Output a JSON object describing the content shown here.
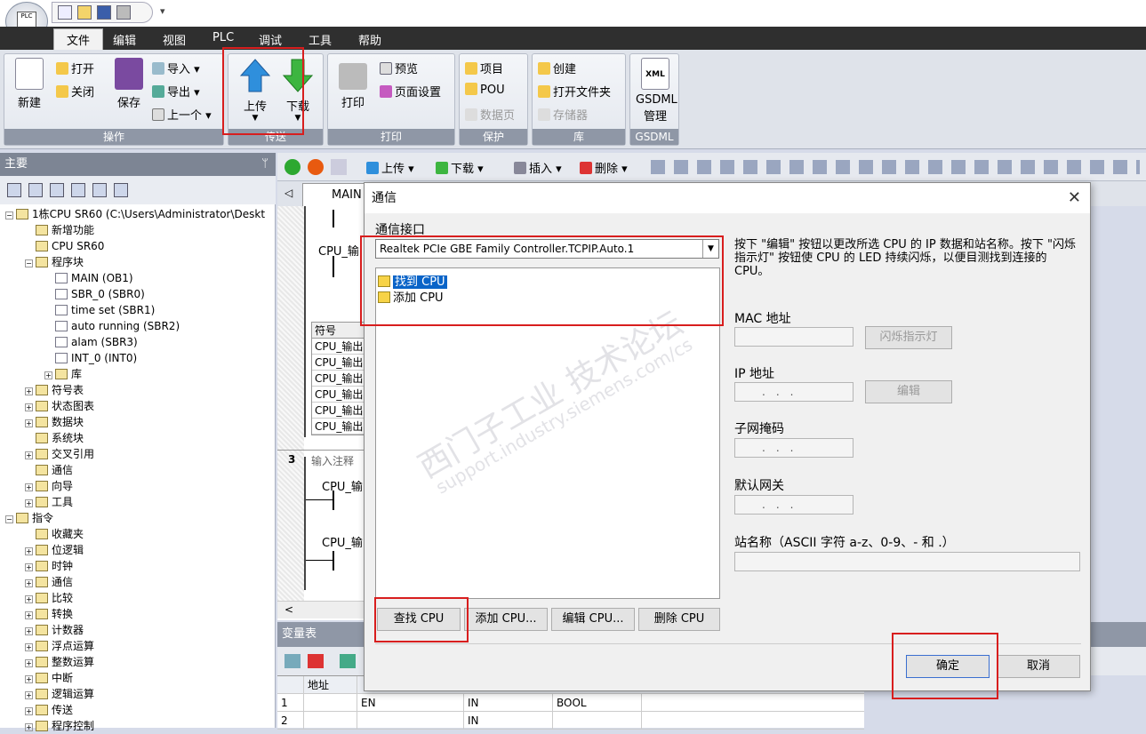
{
  "quick_access_more": "▾",
  "menu": {
    "tabs": [
      "文件",
      "编辑",
      "视图",
      "PLC",
      "调试",
      "工具",
      "帮助"
    ],
    "active": "文件"
  },
  "ribbon": {
    "ops": {
      "caption": "操作",
      "new": "新建",
      "open": "打开",
      "close": "关闭",
      "save": "保存",
      "import": "导入",
      "export": "导出",
      "previous": "上一个"
    },
    "transfer": {
      "caption": "传送",
      "upload": "上传",
      "download": "下载"
    },
    "print": {
      "caption": "打印",
      "print": "打印",
      "preview": "预览",
      "page_setup": "页面设置"
    },
    "protect": {
      "caption": "保护",
      "project": "项目",
      "pou": "POU",
      "data_page": "数据页"
    },
    "library": {
      "caption": "库",
      "create": "创建",
      "open_folder": "打开文件夹",
      "memory": "存储器"
    },
    "gsdml": {
      "caption": "GSDML",
      "label1": "GSDML",
      "label2": "管理",
      "icon_text": "XML"
    }
  },
  "left_pane": {
    "title": "主要",
    "pin": "ᛘ",
    "tree": [
      {
        "label": "1栋CPU SR60 (C:\\Users\\Administrator\\Deskt",
        "level": 0,
        "exp": "−"
      },
      {
        "label": "新增功能",
        "level": 1
      },
      {
        "label": "CPU SR60",
        "level": 1
      },
      {
        "label": "程序块",
        "level": 1,
        "exp": "−"
      },
      {
        "label": "MAIN (OB1)",
        "level": 2
      },
      {
        "label": "SBR_0 (SBR0)",
        "level": 2
      },
      {
        "label": "time set (SBR1)",
        "level": 2
      },
      {
        "label": "auto running (SBR2)",
        "level": 2
      },
      {
        "label": "alam (SBR3)",
        "level": 2
      },
      {
        "label": "INT_0 (INT0)",
        "level": 2
      },
      {
        "label": "库",
        "level": 2,
        "exp": "+"
      },
      {
        "label": "符号表",
        "level": 1,
        "exp": "+"
      },
      {
        "label": "状态图表",
        "level": 1,
        "exp": "+"
      },
      {
        "label": "数据块",
        "level": 1,
        "exp": "+"
      },
      {
        "label": "系统块",
        "level": 1
      },
      {
        "label": "交叉引用",
        "level": 1,
        "exp": "+"
      },
      {
        "label": "通信",
        "level": 1
      },
      {
        "label": "向导",
        "level": 1,
        "exp": "+"
      },
      {
        "label": "工具",
        "level": 1,
        "exp": "+"
      },
      {
        "label": "指令",
        "level": 0,
        "exp": "−"
      },
      {
        "label": "收藏夹",
        "level": 1
      },
      {
        "label": "位逻辑",
        "level": 1,
        "exp": "+"
      },
      {
        "label": "时钟",
        "level": 1,
        "exp": "+"
      },
      {
        "label": "通信",
        "level": 1,
        "exp": "+"
      },
      {
        "label": "比较",
        "level": 1,
        "exp": "+"
      },
      {
        "label": "转换",
        "level": 1,
        "exp": "+"
      },
      {
        "label": "计数器",
        "level": 1,
        "exp": "+"
      },
      {
        "label": "浮点运算",
        "level": 1,
        "exp": "+"
      },
      {
        "label": "整数运算",
        "level": 1,
        "exp": "+"
      },
      {
        "label": "中断",
        "level": 1,
        "exp": "+"
      },
      {
        "label": "逻辑运算",
        "level": 1,
        "exp": "+"
      },
      {
        "label": "传送",
        "level": 1,
        "exp": "+"
      },
      {
        "label": "程序控制",
        "level": 1,
        "exp": "+"
      }
    ]
  },
  "editor_toolbar": {
    "upload": "上传",
    "download": "下载",
    "insert": "插入",
    "delete": "删除",
    "dropdown": "▾"
  },
  "editor": {
    "tab": "MAIN",
    "nav_left": "◁",
    "nav_bottom": "<",
    "rung_label_1": "CPU_输",
    "rung_label_2": "CPU_输",
    "rung_label_3": "CPU_输",
    "symbol_header": "符号",
    "symbol_rows": [
      "CPU_输出",
      "CPU_输出",
      "CPU_输出",
      "CPU_输出",
      "CPU_输出",
      "CPU_输出"
    ],
    "network3": "3",
    "comment": "输入注释"
  },
  "var_table": {
    "title": "变量表",
    "col_address": "地址",
    "rows": [
      {
        "n": "1",
        "name": "EN",
        "type": "IN",
        "dtype": "BOOL"
      },
      {
        "n": "2",
        "name": "",
        "type": "IN",
        "dtype": ""
      }
    ]
  },
  "dialog": {
    "title": "通信",
    "close": "✕",
    "interface_label": "通信接口",
    "interface_value": "Realtek PCIe GBE Family Controller.TCPIP.Auto.1",
    "select_arrow": "▼",
    "cpu_items": [
      {
        "label": "找到 CPU",
        "selected": true
      },
      {
        "label": "添加 CPU",
        "selected": false
      }
    ],
    "help": "按下 \"编辑\" 按钮以更改所选 CPU 的 IP 数据和站名称。按下 \"闪烁指示灯\" 按钮使 CPU 的 LED 持续闪烁，以便目测找到连接的 CPU。",
    "mac_label": "MAC 地址",
    "blink_button": "闪烁指示灯",
    "ip_label": "IP 地址",
    "edit_button": "编辑",
    "subnet_label": "子网掩码",
    "gateway_label": "默认网关",
    "station_label": "站名称（ASCII 字符 a-z、0-9、- 和 .）",
    "ip_placeholder": "...",
    "find_cpu": "查找 CPU",
    "add_cpu": "添加 CPU...",
    "edit_cpu": "编辑 CPU...",
    "delete_cpu": "删除 CPU",
    "ok": "确定",
    "cancel": "取消"
  },
  "watermark": {
    "line1": "西门子工业  技术论坛",
    "line2": "support.industry.siemens.com/cs"
  },
  "colors": {
    "highlight": "#d81e1e",
    "selection": "#0a64c8",
    "menubar": "#2f2f2f"
  }
}
